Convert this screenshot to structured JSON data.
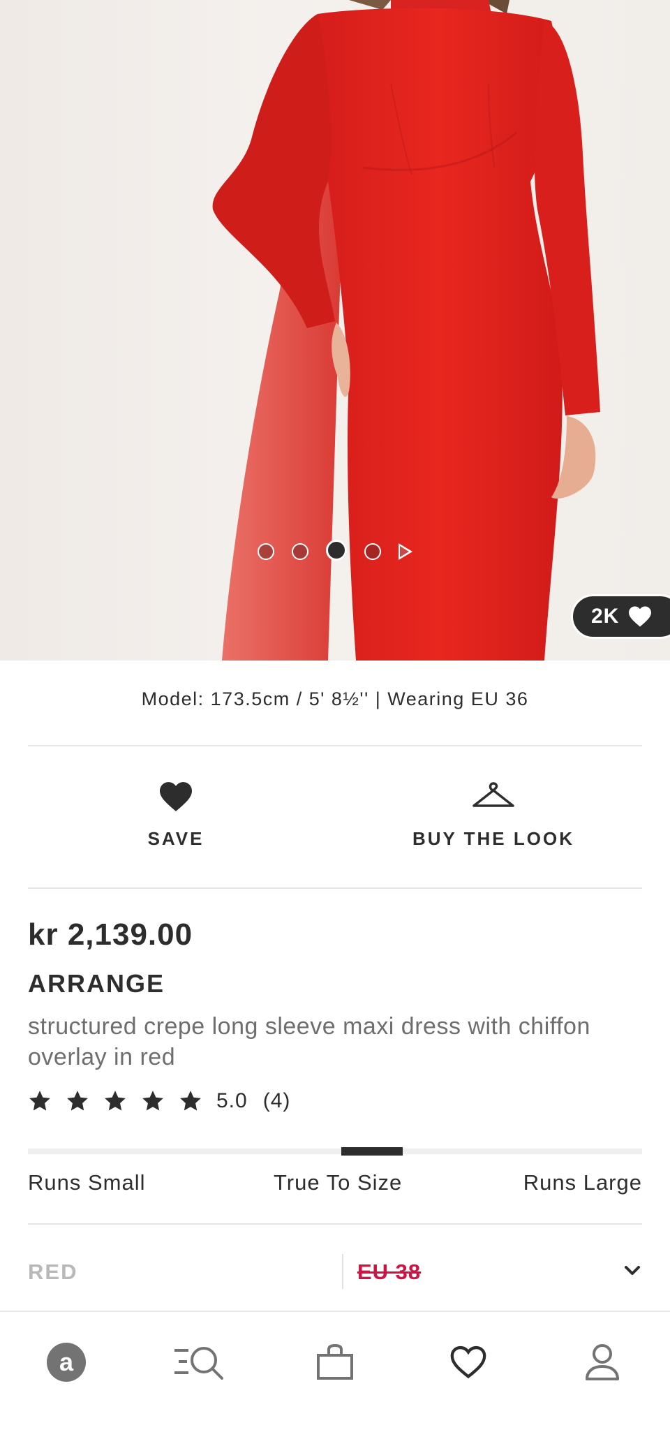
{
  "hero": {
    "carousel_total": 4,
    "carousel_active": 3,
    "likes": "2K"
  },
  "model_info": "Model: 173.5cm / 5' 8½'' | Wearing EU 36",
  "actions": {
    "save_label": "SAVE",
    "buy_the_look_label": "BUY THE LOOK"
  },
  "product": {
    "price": "kr 2,139.00",
    "brand": "ARRANGE",
    "name": "structured crepe long sleeve maxi dress with chiffon overlay in red",
    "rating_value": 5.0,
    "rating_text": "5.0",
    "review_count": "(4)"
  },
  "fit": {
    "labels": [
      "Runs Small",
      "True To Size",
      "Runs Large"
    ],
    "position_fraction": 0.56
  },
  "selectors": {
    "colour": "RED",
    "size": "EU 38"
  },
  "bottom_nav": {
    "items": [
      "home-icon",
      "search-icon",
      "bag-icon",
      "saved-icon",
      "account-icon"
    ]
  },
  "colors": {
    "dress_red": "#e3221f",
    "text_dark": "#2d2d2d",
    "text_grey": "#6e6e6e",
    "size_unavailable": "#d01345"
  }
}
